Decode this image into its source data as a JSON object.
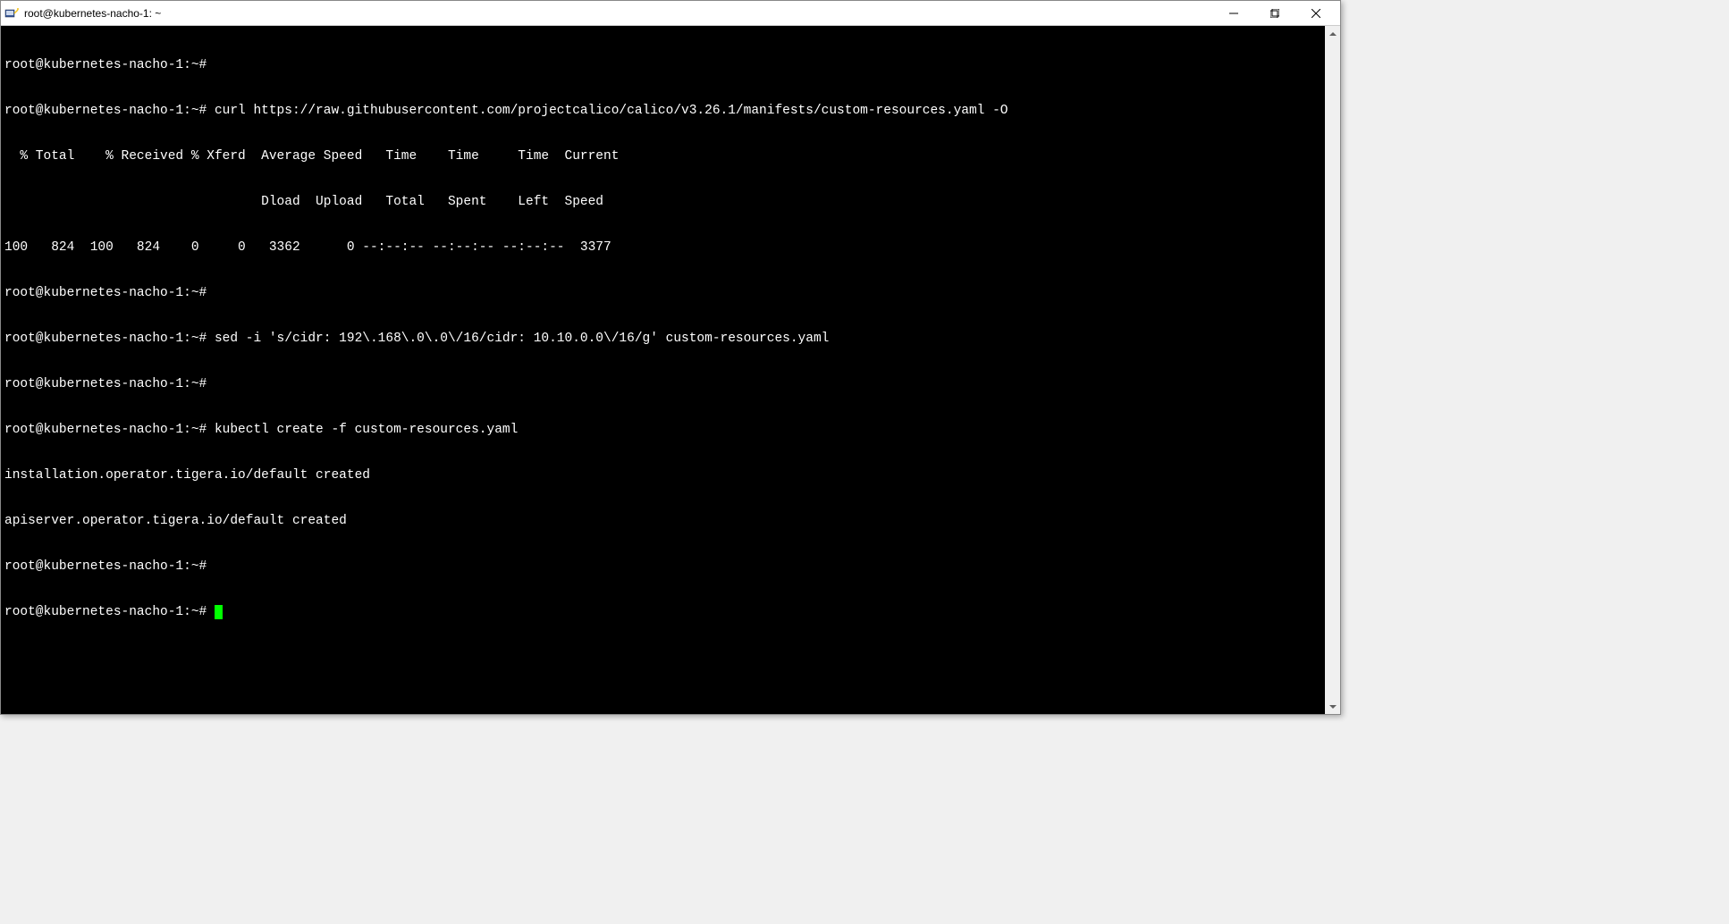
{
  "window": {
    "title": "root@kubernetes-nacho-1: ~"
  },
  "terminal": {
    "lines": [
      "root@kubernetes-nacho-1:~#",
      "root@kubernetes-nacho-1:~# curl https://raw.githubusercontent.com/projectcalico/calico/v3.26.1/manifests/custom-resources.yaml -O",
      "  % Total    % Received % Xferd  Average Speed   Time    Time     Time  Current",
      "                                 Dload  Upload   Total   Spent    Left  Speed",
      "100   824  100   824    0     0   3362      0 --:--:-- --:--:-- --:--:--  3377",
      "root@kubernetes-nacho-1:~#",
      "root@kubernetes-nacho-1:~# sed -i 's/cidr: 192\\.168\\.0\\.0\\/16/cidr: 10.10.0.0\\/16/g' custom-resources.yaml",
      "root@kubernetes-nacho-1:~#",
      "root@kubernetes-nacho-1:~# kubectl create -f custom-resources.yaml",
      "installation.operator.tigera.io/default created",
      "apiserver.operator.tigera.io/default created",
      "root@kubernetes-nacho-1:~#",
      "root@kubernetes-nacho-1:~# "
    ]
  }
}
